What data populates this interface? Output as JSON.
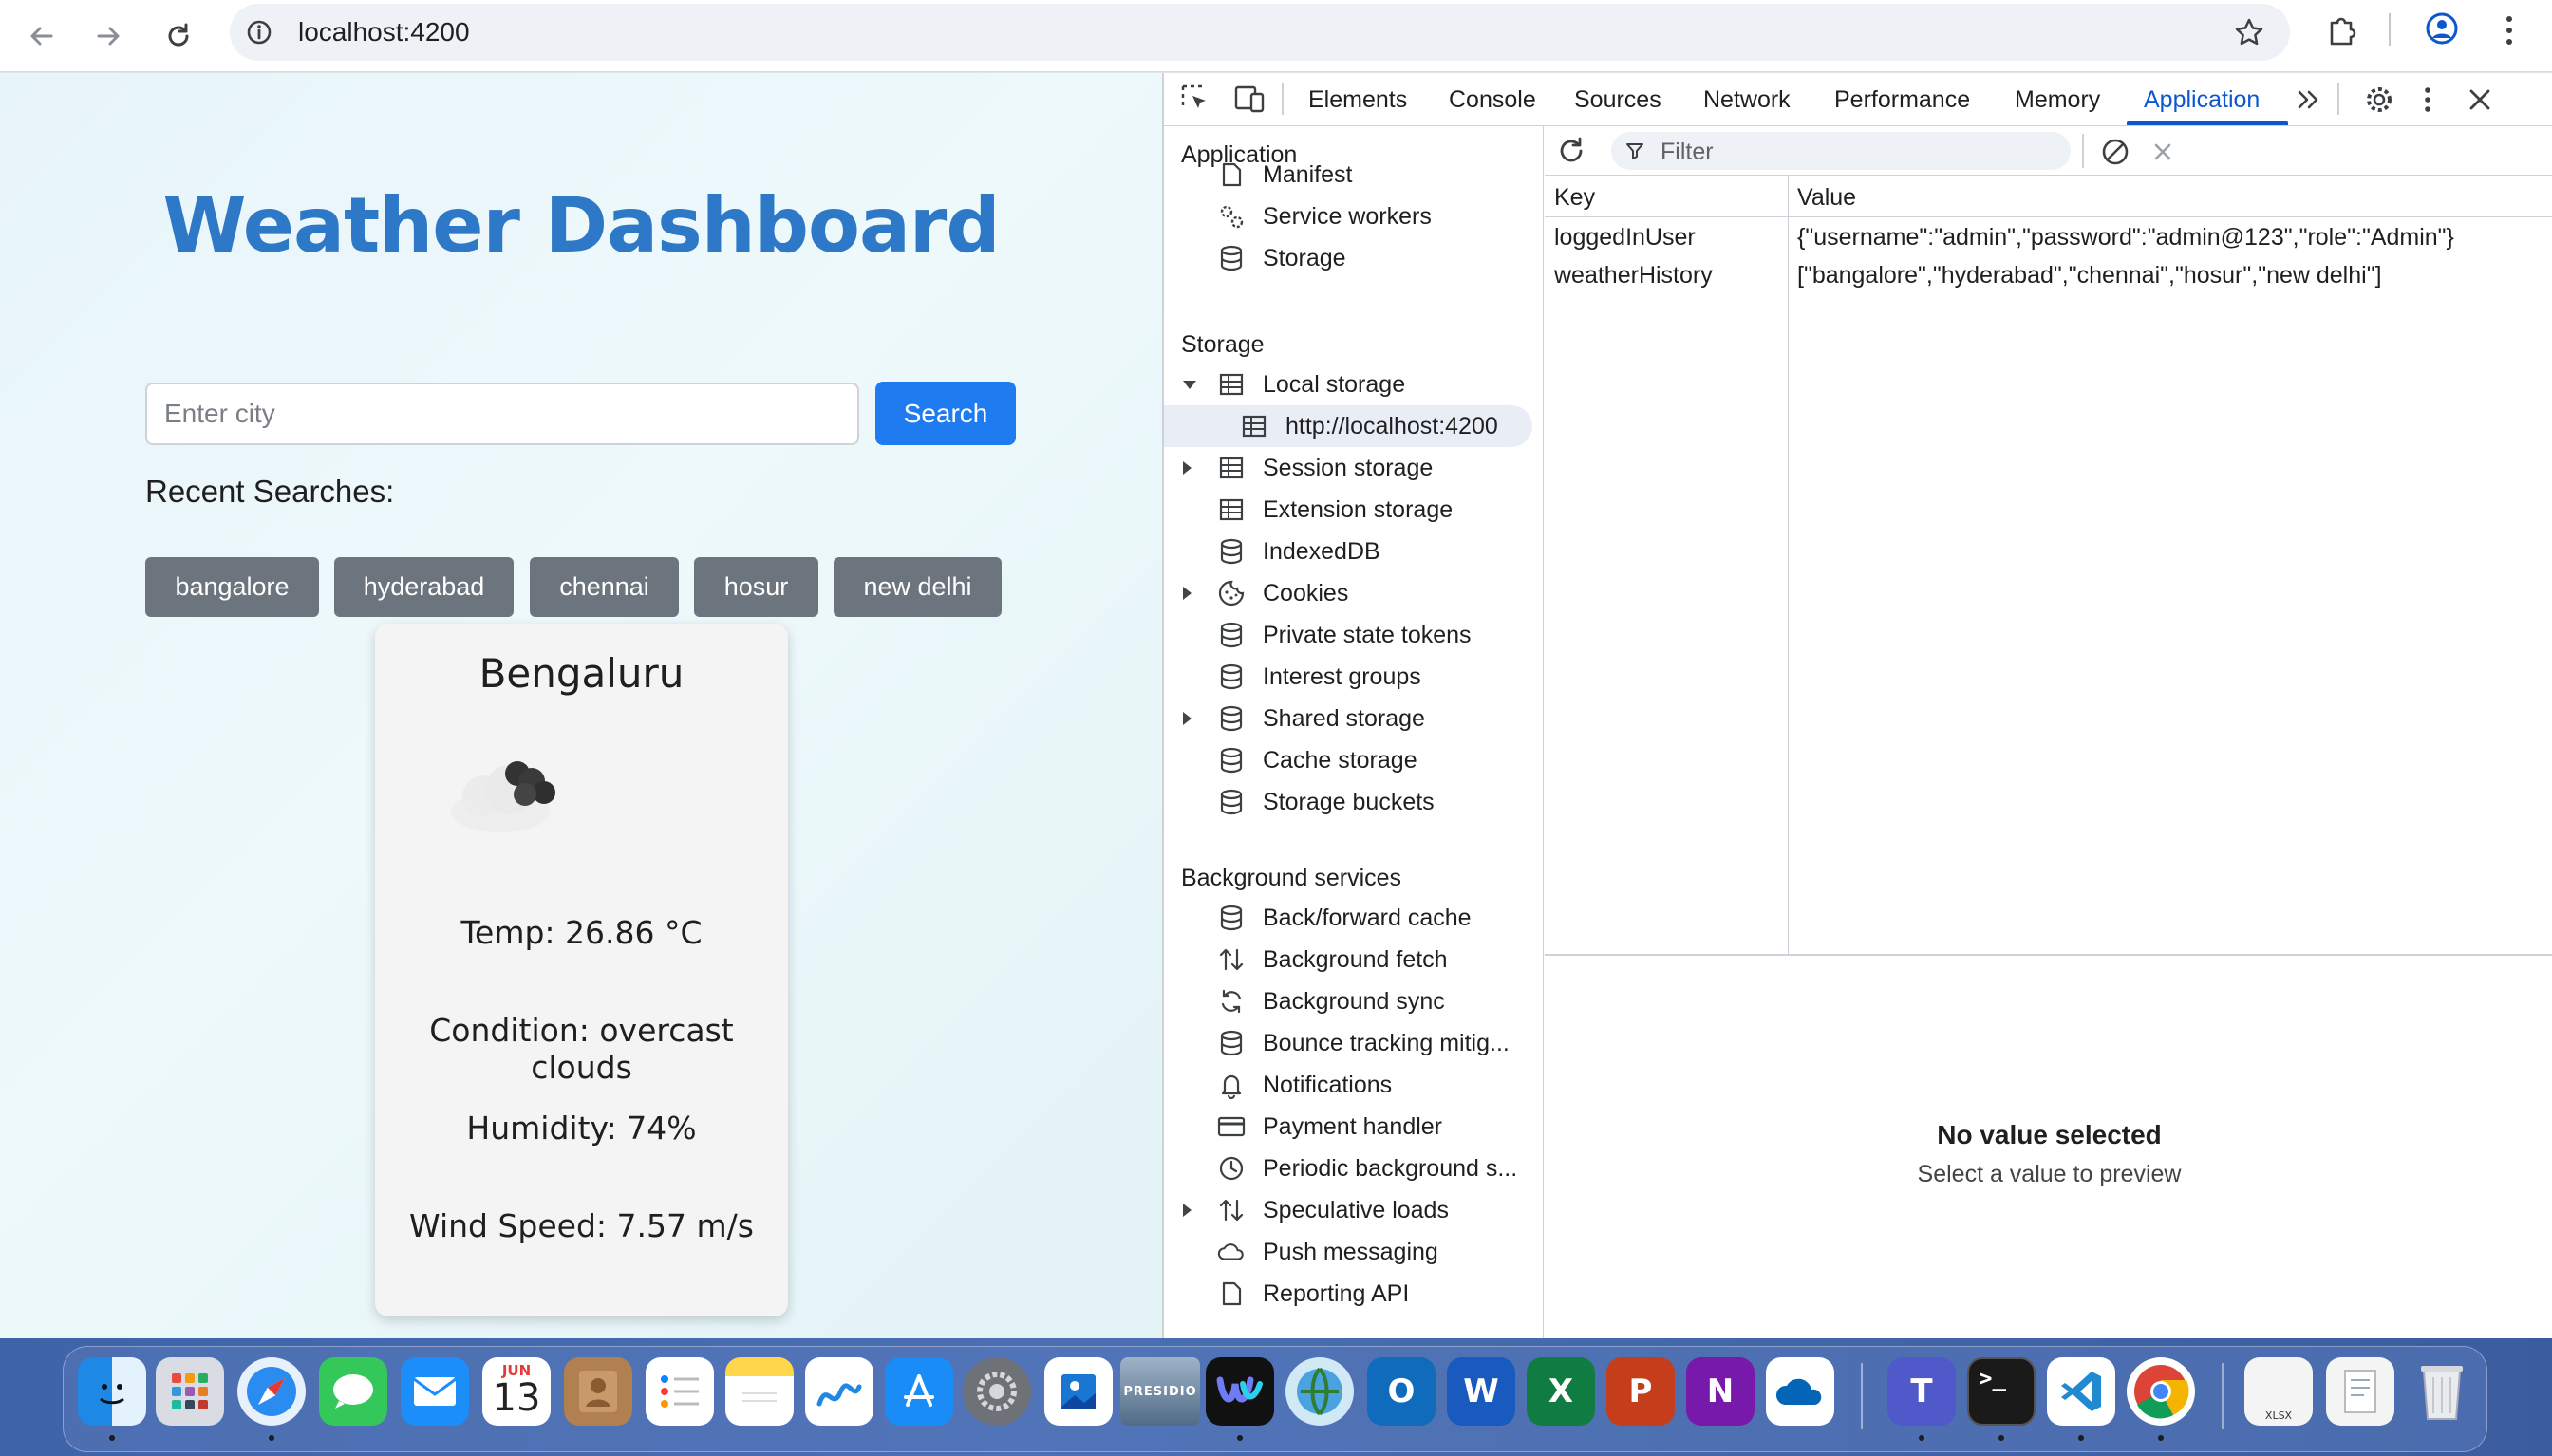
{
  "browser": {
    "url": "localhost:4200"
  },
  "page": {
    "title": "Weather Dashboard",
    "search_placeholder": "Enter city",
    "search_value": "",
    "search_button": "Search",
    "recent_title": "Recent Searches:",
    "recent": [
      "bangalore",
      "hyderabad",
      "chennai",
      "hosur",
      "new delhi"
    ],
    "card": {
      "city": "Bengaluru",
      "temp": "Temp: 26.86 °C",
      "condition": "Condition: overcast clouds",
      "humidity": "Humidity: 74%",
      "wind": "Wind Speed: 7.57 m/s"
    }
  },
  "devtools": {
    "tabs": [
      "Elements",
      "Console",
      "Sources",
      "Network",
      "Performance",
      "Memory",
      "Application"
    ],
    "active_tab": "Application",
    "filter_placeholder": "Filter",
    "sections": {
      "application": "Application",
      "storage": "Storage",
      "background": "Background services"
    },
    "application_items": [
      "Manifest",
      "Service workers",
      "Storage"
    ],
    "storage_items": [
      "Local storage",
      "http://localhost:4200",
      "Session storage",
      "Extension storage",
      "IndexedDB",
      "Cookies",
      "Private state tokens",
      "Interest groups",
      "Shared storage",
      "Cache storage",
      "Storage buckets"
    ],
    "background_items": [
      "Back/forward cache",
      "Background fetch",
      "Background sync",
      "Bounce tracking mitig...",
      "Notifications",
      "Payment handler",
      "Periodic background s...",
      "Speculative loads",
      "Push messaging",
      "Reporting API"
    ],
    "table": {
      "key_header": "Key",
      "value_header": "Value",
      "rows": [
        {
          "key": "loggedInUser",
          "value": "{\"username\":\"admin\",\"password\":\"admin@123\",\"role\":\"Admin\"}"
        },
        {
          "key": "weatherHistory",
          "value": "[\"bangalore\",\"hyderabad\",\"chennai\",\"hosur\",\"new delhi\"]"
        }
      ]
    },
    "preview_title": "No value selected",
    "preview_sub": "Select a value to preview"
  },
  "dock": {
    "calendar_month": "JUN",
    "calendar_day": "13",
    "presidio_label": "PRESIDIO",
    "xlsx_label": "XLSX"
  },
  "colors": {
    "title_blue": "#2d79c7",
    "search_button": "#1f7bf0",
    "chip_gray": "#6c757d",
    "devtools_accent": "#0b57d0"
  }
}
